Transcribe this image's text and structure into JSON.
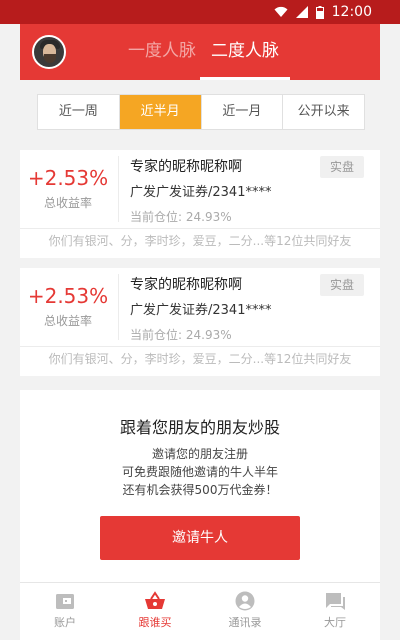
{
  "status_bar": {
    "time": "12:00"
  },
  "header": {
    "tabs": [
      {
        "label": "一度人脉",
        "active": false
      },
      {
        "label": "二度人脉",
        "active": true
      }
    ]
  },
  "filters": {
    "options": [
      "近一周",
      "近半月",
      "近一月",
      "公开以来"
    ],
    "selected": "近半月"
  },
  "cards": [
    {
      "return_value": "+2.53%",
      "return_label": "总收益率",
      "name": "专家的昵称昵称啊",
      "broker": "广发广发证券/2341****",
      "position": "当前仓位: 24.93%",
      "tag": "实盘",
      "friends": "你们有银河、分，李时珍，爱豆，二分...等12位共同好友"
    },
    {
      "return_value": "+2.53%",
      "return_label": "总收益率",
      "name": "专家的昵称昵称啊",
      "broker": "广发广发证券/2341****",
      "position": "当前仓位: 24.93%",
      "tag": "实盘",
      "friends": "你们有银河、分，李时珍，爱豆，二分...等12位共同好友"
    }
  ],
  "invite": {
    "title": "跟着您朋友的朋友炒股",
    "lines": [
      "邀请您的朋友注册",
      "可免费跟随他邀请的牛人半年",
      "还有机会获得500万代金券！"
    ],
    "button": "邀请牛人"
  },
  "bottom_nav": {
    "items": [
      {
        "label": "账户",
        "icon": "wallet-icon",
        "active": false
      },
      {
        "label": "跟谁买",
        "icon": "basket-icon",
        "active": true
      },
      {
        "label": "通讯录",
        "icon": "contacts-icon",
        "active": false
      },
      {
        "label": "大厅",
        "icon": "chat-icon",
        "active": false
      }
    ]
  },
  "colors": {
    "primary": "#e53935",
    "status_bar": "#b71c1c",
    "filter_active": "#f5a623"
  }
}
